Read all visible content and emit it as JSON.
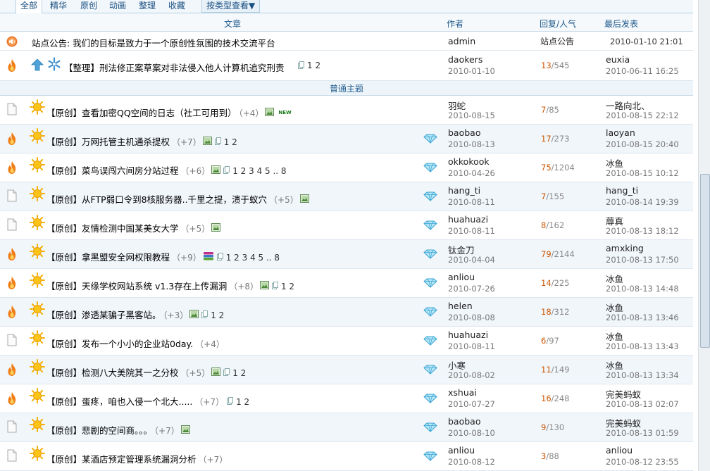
{
  "tabs": [
    {
      "label": "全部",
      "active": true
    },
    {
      "label": "精华"
    },
    {
      "label": "原创"
    },
    {
      "label": "动画"
    },
    {
      "label": "整理"
    },
    {
      "label": "收藏"
    }
  ],
  "filter_dropdown": "按类型查看▼",
  "columns": {
    "topic": "文章",
    "author": "作者",
    "replies": "回复/人气",
    "last": "最后发表"
  },
  "announcement": {
    "title": "站点公告: 我们的目标是致力于一个原创性氛围的技术交流平台",
    "author": "admin",
    "replies_text": "站点公告",
    "last_time": "2010-01-10 21:01",
    "icon": "speaker-icon"
  },
  "pinned": {
    "title": "【整理】刑法修正案草案对非法侵入他人计算机追究刑责",
    "pages": "1 2",
    "author": "daokers",
    "date": "2010-01-10",
    "replies": "13",
    "views": "/545",
    "last_user": "euxia",
    "last_time": "2010-06-11 16:25"
  },
  "section_label": "普通主题",
  "colors": {
    "accent": "#1f5a8c",
    "reply": "#cc5500",
    "hot": "#f07d17",
    "section_bg": "#eef5fa"
  },
  "threads": [
    {
      "hot": false,
      "title": "【原创】查看加密QQ空间的日志（社工可用到）",
      "score": "（+4）",
      "img": true,
      "new": true,
      "new_label": "NEW",
      "multi": false,
      "pages": "",
      "diamond": false,
      "author": "羽蛇",
      "date": "2010-08-15",
      "replies": "7",
      "views": "/85",
      "last_user": "一路向北、",
      "last_time": "2010-08-15 22:12"
    },
    {
      "hot": true,
      "title": "【原创】万网托管主机通杀提权",
      "score": "（+7）",
      "img": true,
      "new": false,
      "multi": true,
      "pages": "1 2",
      "diamond": true,
      "author": "baobao",
      "date": "2010-08-13",
      "replies": "17",
      "views": "/273",
      "last_user": "laoyan",
      "last_time": "2010-08-15 20:40"
    },
    {
      "hot": true,
      "title": "【原创】菜鸟误闯六间房分站过程",
      "score": "（+6）",
      "img": true,
      "new": false,
      "multi": true,
      "pages": "1 2 3 4 5 .. 8",
      "diamond": true,
      "author": "okkokook",
      "date": "2010-04-26",
      "replies": "75",
      "views": "/1204",
      "last_user": "冰鱼",
      "last_time": "2010-08-15 10:12"
    },
    {
      "hot": false,
      "title": "【原创】从FTP弱口令到8核服务器..千里之提，溃于蚁穴",
      "score": "（+5）",
      "img": true,
      "new": false,
      "multi": false,
      "pages": "",
      "diamond": true,
      "author": "hang_ti",
      "date": "2010-08-11",
      "replies": "7",
      "views": "/155",
      "last_user": "hang_ti",
      "last_time": "2010-08-14 19:39"
    },
    {
      "hot": false,
      "title": "【原创】友情检测中国某美女大学",
      "score": "（+5）",
      "img": true,
      "new": false,
      "multi": false,
      "pages": "",
      "diamond": true,
      "author": "huahuazi",
      "date": "2010-08-11",
      "replies": "8",
      "views": "/162",
      "last_user": "蓐真",
      "last_time": "2010-08-13 18:12"
    },
    {
      "hot": true,
      "title": "【原创】拿黑盟安全网权限教程",
      "score": "（+9）",
      "img": false,
      "stack": true,
      "new": false,
      "multi": true,
      "pages": "1 2 3 4 5 .. 8",
      "diamond": true,
      "author": "钛金刀",
      "date": "2010-04-04",
      "replies": "79",
      "views": "/2144",
      "last_user": "amxking",
      "last_time": "2010-08-13 17:50"
    },
    {
      "hot": true,
      "title": "【原创】天缘学校网站系统 v1.3存在上传漏洞",
      "score": "（+8）",
      "img": true,
      "new": false,
      "multi": true,
      "pages": "1 2",
      "diamond": true,
      "author": "anliou",
      "date": "2010-07-26",
      "replies": "14",
      "views": "/225",
      "last_user": "冰鱼",
      "last_time": "2010-08-13 14:48"
    },
    {
      "hot": true,
      "title": "【原创】渗透某骗子黑客站。",
      "score": "（+3）",
      "img": true,
      "new": false,
      "multi": true,
      "pages": "1 2",
      "diamond": true,
      "author": "helen",
      "date": "2010-08-08",
      "replies": "18",
      "views": "/312",
      "last_user": "冰鱼",
      "last_time": "2010-08-13 13:46"
    },
    {
      "hot": false,
      "title": "【原创】发布一个小小的企业站0day.",
      "score": "（+4）",
      "img": false,
      "new": false,
      "multi": false,
      "pages": "",
      "diamond": true,
      "author": "huahuazi",
      "date": "2010-08-11",
      "replies": "6",
      "views": "/97",
      "last_user": "冰鱼",
      "last_time": "2010-08-13 13:43"
    },
    {
      "hot": true,
      "title": "【原创】检测八大美院其一之分校",
      "score": "（+5）",
      "img": true,
      "new": false,
      "multi": true,
      "pages": "1 2",
      "diamond": true,
      "author": "小寒",
      "date": "2010-08-02",
      "replies": "11",
      "views": "/149",
      "last_user": "冰鱼",
      "last_time": "2010-08-13 13:34"
    },
    {
      "hot": true,
      "title": "【原创】蛋疼，咱也入侵一个北大.....",
      "score": "（+7）",
      "img": false,
      "new": false,
      "multi": true,
      "pages": "1 2",
      "diamond": true,
      "author": "xshuai",
      "date": "2010-07-27",
      "replies": "16",
      "views": "/248",
      "last_user": "完美蚂蚁",
      "last_time": "2010-08-13 02:07"
    },
    {
      "hot": false,
      "title": "【原创】悲剧的空间商。。。",
      "score": "（+7）",
      "img": true,
      "new": false,
      "multi": false,
      "pages": "",
      "diamond": true,
      "author": "baobao",
      "date": "2010-08-10",
      "replies": "9",
      "views": "/130",
      "last_user": "完美蚂蚁",
      "last_time": "2010-08-13 01:59"
    },
    {
      "hot": false,
      "title": "【原创】某酒店预定管理系统漏洞分析",
      "score": "（+7）",
      "img": false,
      "new": false,
      "multi": false,
      "pages": "",
      "diamond": true,
      "author": "anliou",
      "date": "2010-08-12",
      "replies": "3",
      "views": "/88",
      "last_user": "anliou",
      "last_time": "2010-08-12 23:55"
    }
  ]
}
